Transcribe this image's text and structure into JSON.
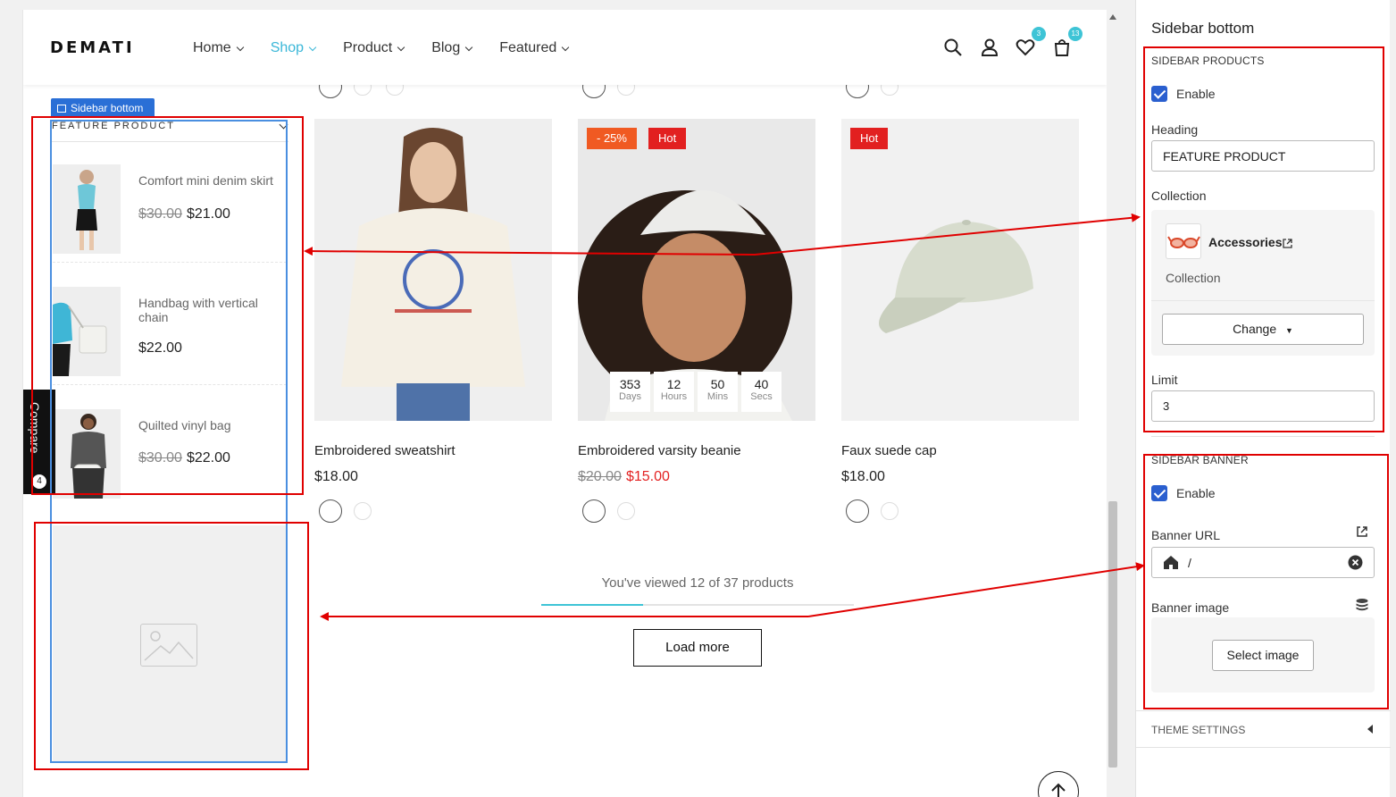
{
  "header": {
    "logo": "DEMATI",
    "nav": [
      "Home",
      "Shop",
      "Product",
      "Blog",
      "Featured"
    ],
    "active_nav": "Shop",
    "wishlist_count": "3",
    "cart_count": "13"
  },
  "sidebar_tag": "Sidebar bottom",
  "sidebar_products": {
    "heading": "FEATURE PRODUCT",
    "items": [
      {
        "name": "Comfort mini denim skirt",
        "old_price": "$30.00",
        "price": "$21.00"
      },
      {
        "name": "Handbag with vertical chain",
        "old_price": "",
        "price": "$22.00"
      },
      {
        "name": "Quilted vinyl bag",
        "old_price": "$30.00",
        "price": "$22.00"
      }
    ]
  },
  "compare": {
    "label": "Compare",
    "count": "4"
  },
  "products": [
    {
      "name": "Embroidered sweatshirt",
      "old_price": "",
      "price": "$18.00",
      "labels": []
    },
    {
      "name": "Embroidered varsity beanie",
      "old_price": "$20.00",
      "price": "$15.00",
      "labels": [
        "- 25%",
        "Hot"
      ],
      "countdown": [
        {
          "n": "353",
          "u": "Days"
        },
        {
          "n": "12",
          "u": "Hours"
        },
        {
          "n": "50",
          "u": "Mins"
        },
        {
          "n": "40",
          "u": "Secs"
        }
      ]
    },
    {
      "name": "Faux suede cap",
      "old_price": "",
      "price": "$18.00",
      "labels": [
        "Hot"
      ]
    }
  ],
  "pagination": {
    "viewed_text": "You've viewed 12 of 37 products",
    "viewed": 12,
    "total": 37,
    "load_more": "Load more"
  },
  "panel": {
    "title": "Sidebar bottom",
    "sidebar_products": {
      "section": "SIDEBAR PRODUCTS",
      "enable_label": "Enable",
      "heading_label": "Heading",
      "heading_value": "FEATURE PRODUCT",
      "collection_label": "Collection",
      "collection_name": "Accessories",
      "collection_type": "Collection",
      "change_label": "Change",
      "limit_label": "Limit",
      "limit_value": "3"
    },
    "sidebar_banner": {
      "section": "SIDEBAR BANNER",
      "enable_label": "Enable",
      "url_label": "Banner URL",
      "url_value": "/",
      "image_label": "Banner image",
      "select_label": "Select image"
    },
    "theme_settings": "THEME SETTINGS"
  },
  "colors": {
    "accent": "#3ab7d8",
    "annotation": "#e00000",
    "selection": "#4a8fe0",
    "sale": "#e32222",
    "checkbox": "#2a5fcf"
  }
}
